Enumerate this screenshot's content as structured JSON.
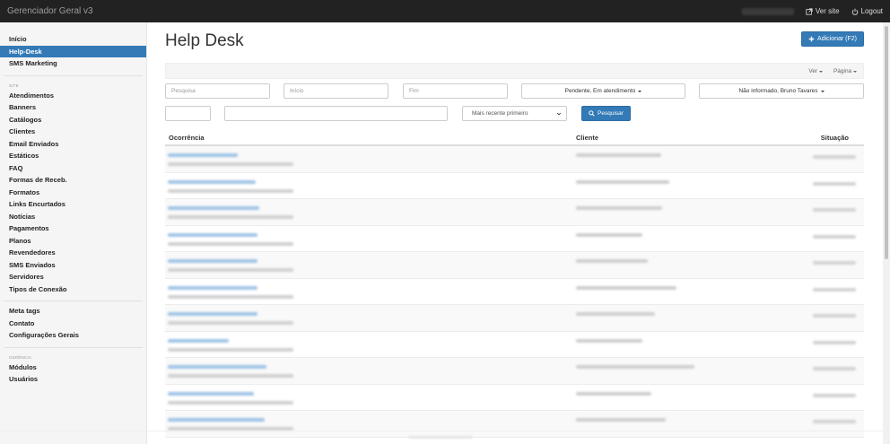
{
  "app": {
    "title": "Gerenciador Geral v3"
  },
  "topbar": {
    "ver_site": "Ver site",
    "logout": "Logout"
  },
  "sidebar": {
    "group1": [
      "Início",
      "Help-Desk",
      "SMS Marketing"
    ],
    "site_header": "SITE",
    "site_items": [
      "Atendimentos",
      "Banners",
      "Catálogos",
      "Clientes",
      "Email Enviados",
      "Estáticos",
      "FAQ",
      "Formas de Receb.",
      "Formatos",
      "Links Encurtados",
      "Notícias",
      "Pagamentos",
      "Planos",
      "Revendedores",
      "SMS Enviados",
      "Servidores",
      "Tipos de Conexão"
    ],
    "group3": [
      "Meta tags",
      "Contato",
      "Configurações Gerais"
    ],
    "gerencia_header": "GERÊNCIA",
    "gerencia_items": [
      "Módulos",
      "Usuários"
    ]
  },
  "main": {
    "title": "Help Desk",
    "add_button": "Adicionar (F2)",
    "toolbar": {
      "ver": "Ver",
      "pagina": "Página"
    },
    "filters": {
      "search_placeholder": "Pesquisa",
      "inicio_placeholder": "Início",
      "fim_placeholder": "Fim",
      "status_dropdown": "Pendente, Em atendimento",
      "responsavel_dropdown": "Não informado, Bruno Tavares",
      "order_select": "Mais recente primeiro",
      "search_button": "Pesquisar"
    },
    "table": {
      "headers": {
        "ocorrencia": "Ocorrência",
        "cliente": "Cliente",
        "situacao": "Situação"
      }
    }
  },
  "colors": {
    "primary": "#337ab7",
    "topbar": "#222222",
    "sidebar": "#f5f5f5"
  }
}
